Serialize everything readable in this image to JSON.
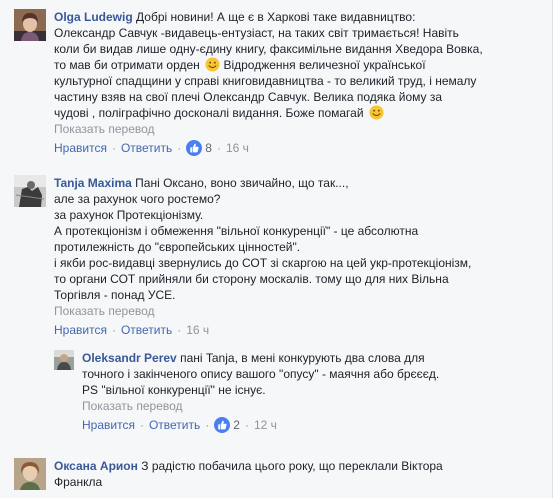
{
  "comments": [
    {
      "author": "Olga Ludewig",
      "text_lines": [
        "Добрі новини! А ще є в Харкові таке видавництво:",
        "Олександр Савчук -видавець-ентузіаст, на таких світ тримається! Навіть",
        "коли би видав лише одну-єдину книгу, факсимільне видання Хведора Вовка,",
        "то мав би отримати орден",
        "Відродження величезної української",
        "культурної спадщини у справі книговидавництва - то великий труд, і немалу",
        "частину взяв на свої плечі Олександр Савчук. Велика подяка йому за",
        "чудові , поліграфічно досконалі видання. Боже помагай"
      ],
      "translate": "Показать перевод",
      "like_label": "Нравится",
      "reply_label": "Ответить",
      "likes": "8",
      "time": "16 ч",
      "reactions_icon": "thumbs-up-icon"
    },
    {
      "author": "Tanja Maxima",
      "text_lines": [
        "Пані Оксано, воно звичайно, що так...,",
        "але за рахунок чого ростемо?",
        "за рахунок Протекціонізму.",
        "А протекціонізм і обмеження \"вільної конкуренції\" - це абсолютна",
        "протилежність до \"європейських цінностей\".",
        "і якби рос-видавці звернулись до СОТ зі скаргою на цей укр-протекціонізм,",
        "то органи СОТ прийняли би сторону москалів. тому що для них Вільна",
        "Торгівля - понад УСЕ."
      ],
      "translate": "Показать перевод",
      "like_label": "Нравится",
      "reply_label": "Ответить",
      "time": "16 ч"
    },
    {
      "author": "Oleksandr Perev",
      "text_lines": [
        "пані Tanja, в мені конкурують два слова для",
        "точного і закінченого опису вашого \"опусу\" - маячня або брєєєд.",
        "PS \"вільної конкуренції\" не існує."
      ],
      "translate": "Показать перевод",
      "like_label": "Нравится",
      "reply_label": "Ответить",
      "likes": "2",
      "time": "12 ч",
      "reactions_icon": "thumbs-up-icon"
    },
    {
      "author": "Оксана Арион",
      "text_lines": [
        "З радістю побачила цього року, що переклали Віктора",
        "Франкла"
      ]
    }
  ],
  "colors": {
    "author": "#385898",
    "link": "#4267b2",
    "meta": "#90949c",
    "like_badge": "#4a7ef1",
    "background": "#f6f7f9"
  }
}
